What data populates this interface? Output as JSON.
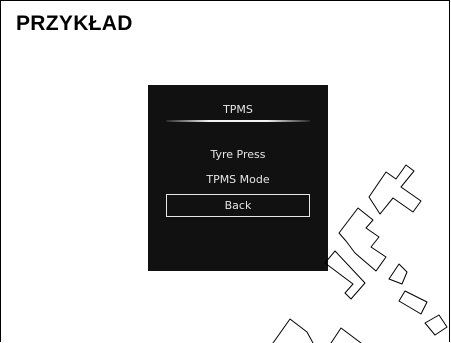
{
  "page": {
    "heading": "PRZYKŁAD"
  },
  "screen": {
    "title": "TPMS",
    "menu_items": [
      {
        "label": "Tyre Press",
        "selected": false
      },
      {
        "label": "TPMS Mode",
        "selected": false
      },
      {
        "label": "Back",
        "selected": true
      }
    ]
  },
  "colors": {
    "screen_background": "#111111",
    "screen_text": "#e6e6e6",
    "watermark_stroke": "#000000"
  }
}
